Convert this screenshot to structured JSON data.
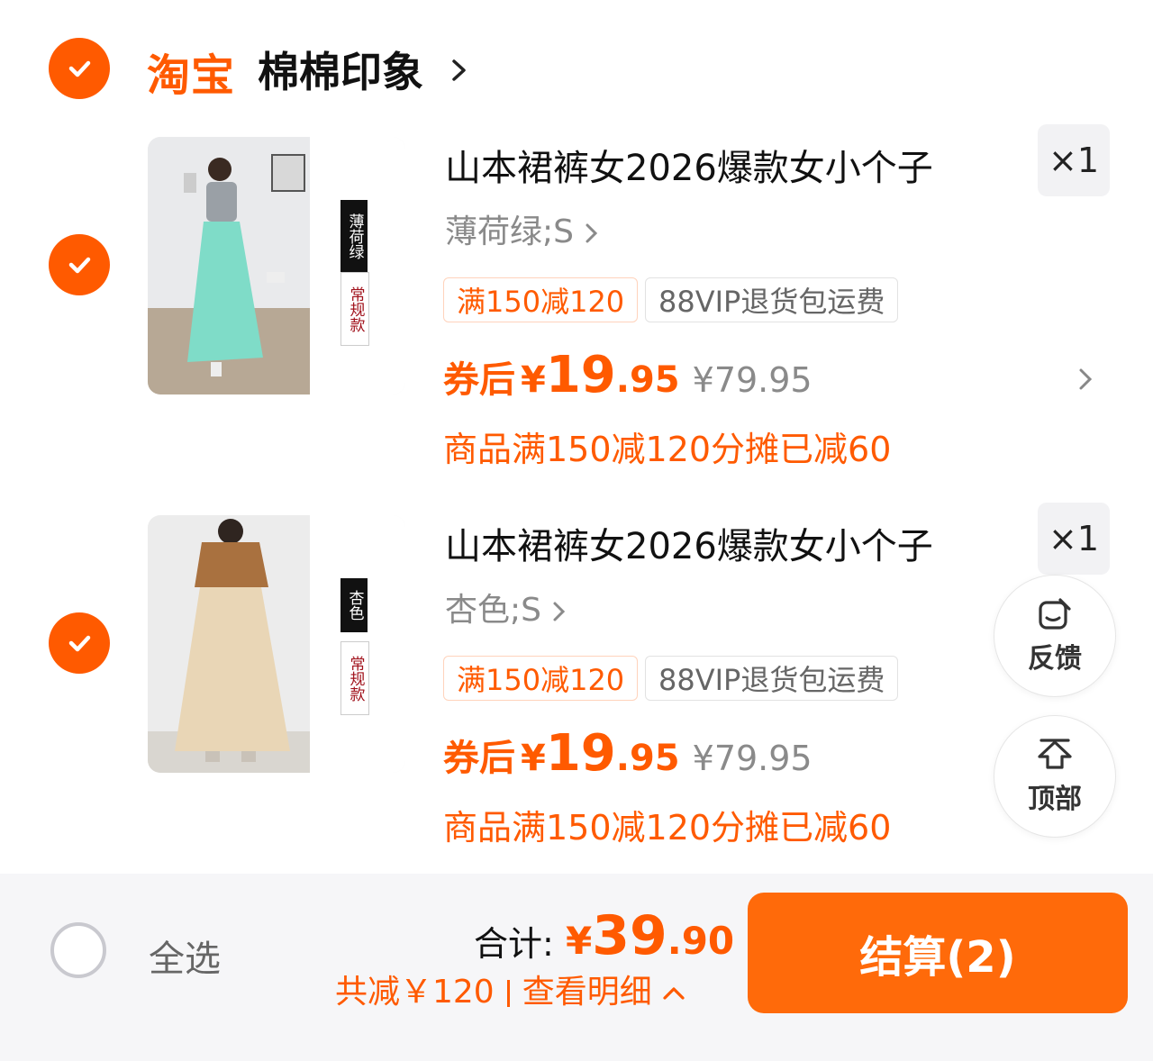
{
  "shop": {
    "brand": "淘宝",
    "name": "棉棉印象",
    "selected": true
  },
  "items": [
    {
      "selected": true,
      "title": "山本裙裤女2026爆款女小个子",
      "quantity": "×1",
      "spec": "薄荷绿;S",
      "thumb_tag_color": "薄荷绿",
      "thumb_tag_style": "常规款",
      "skirt_color": "#7fdcc8",
      "tags": {
        "promo": "满150减120",
        "vip": "88VIP退货包运费"
      },
      "price": {
        "label": "券后",
        "currency": "¥",
        "integer": "19",
        "decimal": ".95",
        "original": "¥79.95"
      },
      "discount_note": "商品满150减120分摊已减60"
    },
    {
      "selected": true,
      "title": "山本裙裤女2026爆款女小个子",
      "quantity": "×1",
      "spec": "杏色;S",
      "thumb_tag_color": "杏色",
      "thumb_tag_style": "常规款",
      "skirt_color": "#e9d6b6",
      "tags": {
        "promo": "满150减120",
        "vip": "88VIP退货包运费"
      },
      "price": {
        "label": "券后",
        "currency": "¥",
        "integer": "19",
        "decimal": ".95",
        "original": "¥79.95"
      },
      "discount_note": "商品满150减120分摊已减60"
    }
  ],
  "floating": {
    "feedback_label": "反馈",
    "top_label": "顶部"
  },
  "footer": {
    "select_all_label": "全选",
    "total_label": "合计:",
    "total_currency": "¥",
    "total_integer": "39",
    "total_decimal": ".90",
    "saved_text": "共减￥120",
    "details_text": "查看明细",
    "checkout_label": "结算(2)"
  },
  "colors": {
    "accent": "#ff5a00",
    "checkout": "#ff6a0a",
    "muted": "#8a8a8a"
  },
  "icons": [
    "check-icon",
    "chevron-right-icon",
    "feedback-icon",
    "back-to-top-icon",
    "chevron-up-icon"
  ]
}
